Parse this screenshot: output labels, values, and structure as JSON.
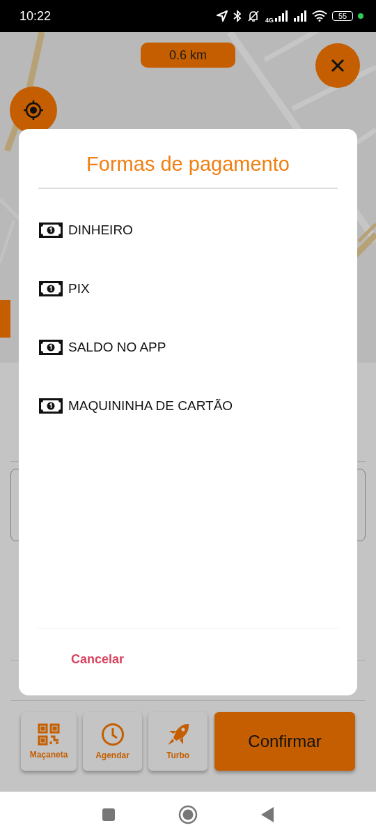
{
  "status_bar": {
    "time": "10:22",
    "network": "4G",
    "battery": "55"
  },
  "map": {
    "distance": "0.6 km"
  },
  "dialog": {
    "title": "Formas de pagamento",
    "options": [
      {
        "label": "DINHEIRO"
      },
      {
        "label": "PIX"
      },
      {
        "label": "SALDO NO APP"
      },
      {
        "label": "MAQUININHA DE CARTÃO"
      }
    ],
    "cancel": "Cancelar"
  },
  "actions": [
    {
      "kind": "qr",
      "label": "Maçaneta"
    },
    {
      "kind": "clock",
      "label": "Agendar"
    },
    {
      "kind": "rocket",
      "label": "Turbo"
    }
  ],
  "confirm": "Confirmar"
}
